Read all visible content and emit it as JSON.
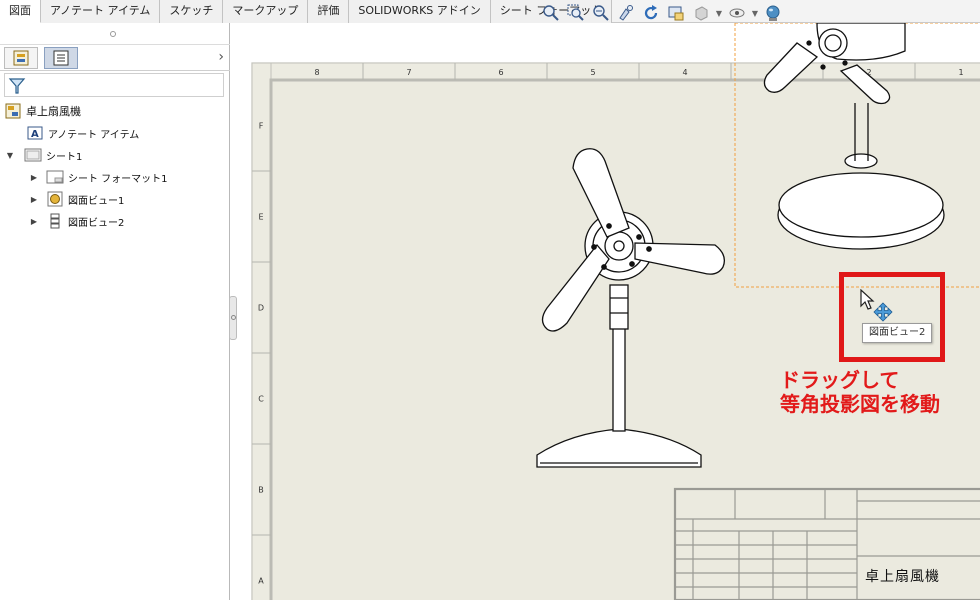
{
  "command_tabs": [
    {
      "label": "図面",
      "active": true
    },
    {
      "label": "アノテート アイテム"
    },
    {
      "label": "スケッチ"
    },
    {
      "label": "マークアップ"
    },
    {
      "label": "評価"
    },
    {
      "label": "SOLIDWORKS アドイン"
    },
    {
      "label": "シート フォーマット"
    }
  ],
  "view_tools": [
    "zoom-to-fit-icon",
    "zoom-to-area-icon",
    "zoom-in-out-icon",
    "pan-icon",
    "redraw-icon",
    "view-settings-icon",
    "display-style-icon",
    "hide-show-icon",
    "appearance-icon"
  ],
  "feature_tree": {
    "root": "卓上扇風機",
    "items": [
      {
        "label": "アノテート アイテム",
        "icon": "annotation-icon"
      },
      {
        "label": "シート1",
        "icon": "sheet-icon",
        "expanded": true
      },
      {
        "label": "シート フォーマット1",
        "icon": "sheet-format-icon"
      },
      {
        "label": "図面ビュー1",
        "icon": "drawing-view-icon"
      },
      {
        "label": "図面ビュー2",
        "icon": "drawing-view-icon"
      }
    ]
  },
  "sheet": {
    "zones_top": [
      "8",
      "7",
      "6",
      "5",
      "4",
      "3",
      "2",
      "1"
    ],
    "zones_left": [
      "F",
      "E",
      "D",
      "C",
      "B",
      "A"
    ],
    "title_block_name": "卓上扇風機"
  },
  "tooltip": "図面ビュー2",
  "annotation": "ドラッグして\n等角投影図を移動",
  "colors": {
    "highlight": "#e01818",
    "annotation": "#e21a1a",
    "sheet": "#ecebe1",
    "selection": "#f0a040"
  }
}
